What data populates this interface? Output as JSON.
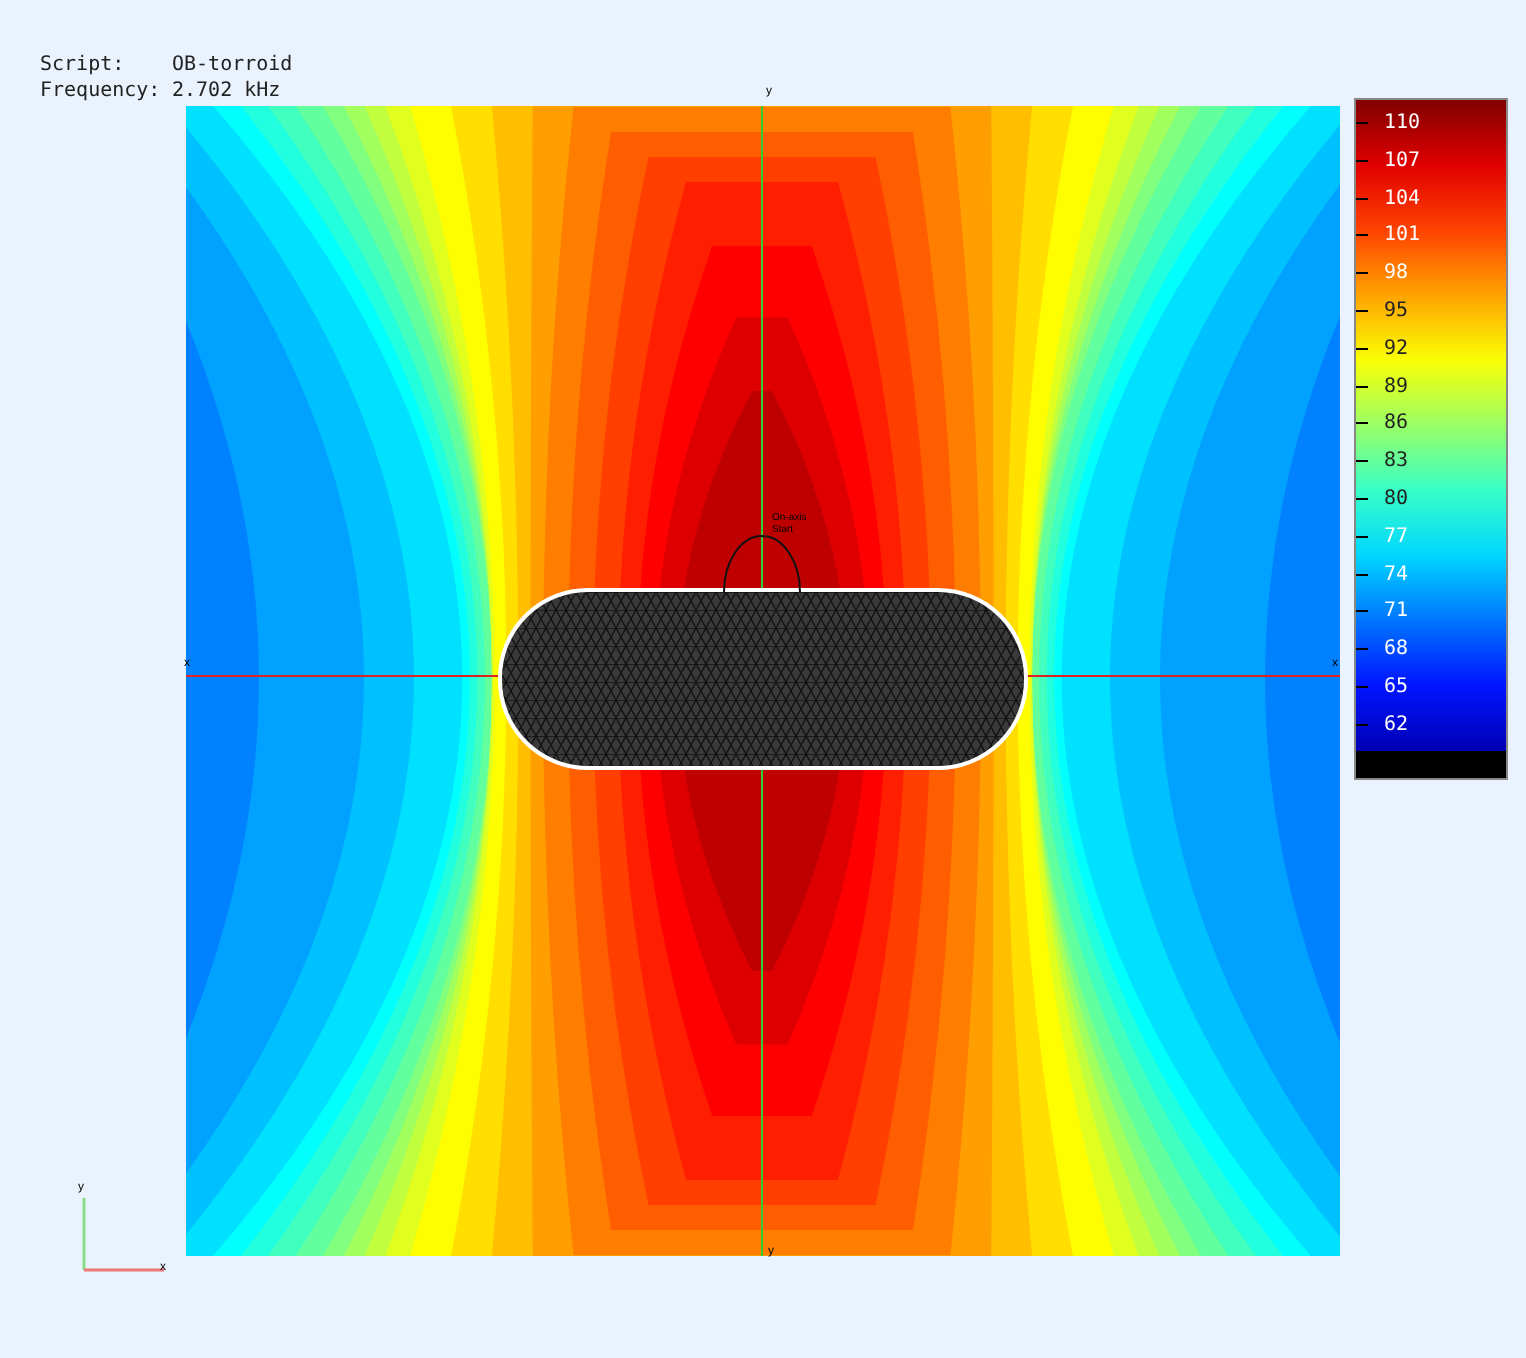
{
  "info": [
    {
      "label": "Script:",
      "value": "OB-torroid"
    },
    {
      "label": "Frequency:",
      "value": "2.702 kHz"
    }
  ],
  "colorbar": {
    "ticks": [
      "110",
      "107",
      "104",
      "101",
      "98",
      "95",
      "92",
      "89",
      "86",
      "83",
      "80",
      "77",
      "74",
      "71",
      "68",
      "65",
      "62"
    ]
  },
  "plot": {
    "probe_label": "On-axis Start",
    "axis_top": "y",
    "axis_bottom": "y",
    "axis_left": "x",
    "axis_right": "x"
  },
  "triad": {
    "y_label": "y",
    "x_label": "x"
  }
}
